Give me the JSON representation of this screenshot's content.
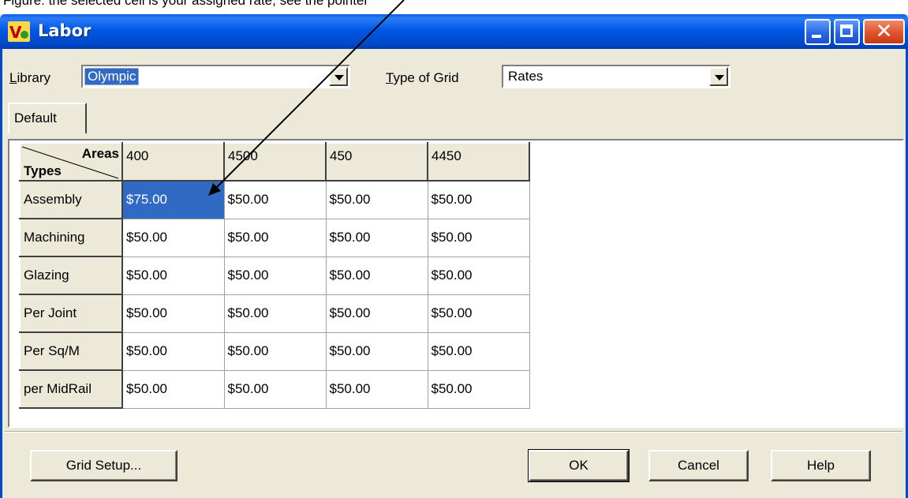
{
  "cropped_caption": "Figure: the selected cell is your assigned rate, see the pointer",
  "window": {
    "title": "Labor"
  },
  "library": {
    "label": "Library",
    "value": "Olympic"
  },
  "grid_type": {
    "label": "Type of Grid",
    "value": "Rates"
  },
  "tabs": [
    {
      "label": "Default"
    }
  ],
  "grid": {
    "corner_top": "Areas",
    "corner_bottom": "Types",
    "columns": [
      "400",
      "4500",
      "450",
      "4450"
    ],
    "rows": [
      {
        "label": "Assembly",
        "values": [
          "$75.00",
          "$50.00",
          "$50.00",
          "$50.00"
        ]
      },
      {
        "label": "Machining",
        "values": [
          "$50.00",
          "$50.00",
          "$50.00",
          "$50.00"
        ]
      },
      {
        "label": "Glazing",
        "values": [
          "$50.00",
          "$50.00",
          "$50.00",
          "$50.00"
        ]
      },
      {
        "label": "Per Joint",
        "values": [
          "$50.00",
          "$50.00",
          "$50.00",
          "$50.00"
        ]
      },
      {
        "label": "Per Sq/M",
        "values": [
          "$50.00",
          "$50.00",
          "$50.00",
          "$50.00"
        ]
      },
      {
        "label": "per MidRail",
        "values": [
          "$50.00",
          "$50.00",
          "$50.00",
          "$50.00"
        ]
      }
    ],
    "selected_cell": {
      "row": 0,
      "col": 0
    }
  },
  "buttons": {
    "grid_setup": "Grid Setup...",
    "ok": "OK",
    "cancel": "Cancel",
    "help": "Help"
  },
  "colors": {
    "selection": "#316ac5",
    "titlebar": "#0058e6",
    "dialog": "#ece9d8"
  }
}
